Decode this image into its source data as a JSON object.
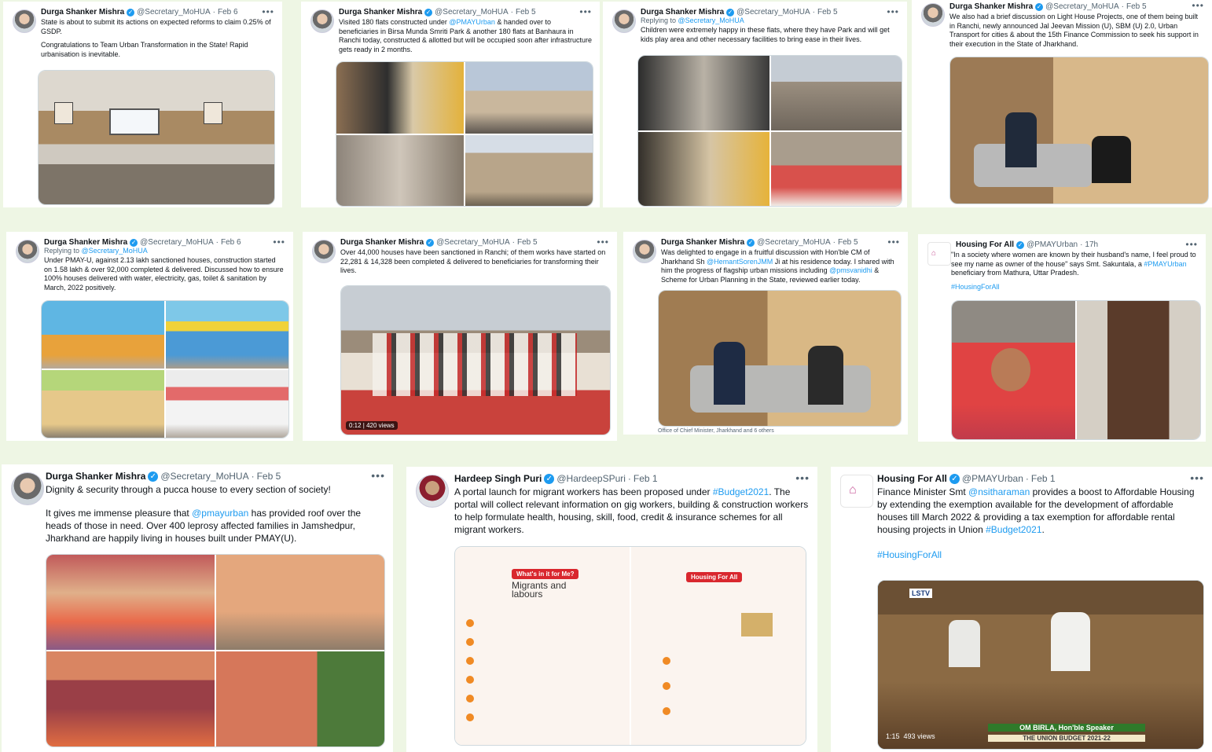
{
  "tweets": [
    {
      "name": "Durga Shanker Mishra",
      "handle": "@Secretary_MoHUA",
      "date": "Feb 6",
      "text1": "State is about to submit its actions on expected reforms to claim 0.25% of GSDP.",
      "text2": "Congratulations to Team Urban Transformation in the State! Rapid urbanisation is inevitable."
    },
    {
      "name": "Durga Shanker Mishra",
      "handle": "@Secretary_MoHUA",
      "date": "Feb 5",
      "pre": "Visited 180 flats constructed under ",
      "link": "@PMAYUrban",
      "post": " & handed over to beneficiaries in Birsa Munda Smriti Park & another 180 flats at Banhaura in Ranchi today, constructed & allotted but will be occupied soon after infrastructure gets ready in 2 months."
    },
    {
      "name": "Durga Shanker Mishra",
      "handle": "@Secretary_MoHUA",
      "date": "Feb 5",
      "replying": "Replying to",
      "reply_to": "@Secretary_MoHUA",
      "text": "Children were extremely happy in these flats, where they have Park and will get kids play area and other necessary facilities to bring ease in their lives."
    },
    {
      "name": "Durga Shanker Mishra",
      "handle": "@Secretary_MoHUA",
      "date": "Feb 5",
      "text": "We also had a brief discussion on Light House Projects, one of them being built in Ranchi, newly announced Jal Jeevan Mission (U), SBM (U) 2.0, Urban Transport for cities & about the 15th Finance Commission to seek his support in their execution in the State of Jharkhand."
    },
    {
      "name": "Durga Shanker Mishra",
      "handle": "@Secretary_MoHUA",
      "date": "Feb 6",
      "replying": "Replying to",
      "reply_to": "@Secretary_MoHUA",
      "text": "Under PMAY-U, against 2.13 lakh sanctioned houses, construction started on 1.58 lakh & over 92,000 completed & delivered. Discussed how to ensure 100% houses delivered with water, electricity, gas, toilet & sanitation by March, 2022 positively."
    },
    {
      "name": "Durga Shanker Mishra",
      "handle": "@Secretary_MoHUA",
      "date": "Feb 5",
      "text": "Over 44,000 houses have been sanctioned in Ranchi; of them works have started on 22,281 & 14,328 been completed & delivered to beneficiaries for transforming their lives.",
      "video_time": "0:12",
      "video_views": "420 views"
    },
    {
      "name": "Durga Shanker Mishra",
      "handle": "@Secretary_MoHUA",
      "date": "Feb 5",
      "pre": "Was delighted to engage in a fruitful discussion with Hon'ble CM of Jharkhand Sh ",
      "link": "@HemantSorenJMM",
      "mid": " Ji at his residence today. I shared with him the progress of flagship urban missions including ",
      "link2": "@pmsvanidhi",
      "post": " & Scheme for Urban Planning in the State, reviewed earlier today.",
      "caption": "Office of Chief Minister, Jharkhand and 6 others"
    },
    {
      "name": "Housing For All",
      "handle": "@PMAYUrban",
      "date": "17h",
      "pre": "\"In a society where women are known by their husband's name, I feel proud to see my name as owner of the house\" says Smt. Sakuntala, a ",
      "link": "#PMAYUrban",
      "post": " beneficiary from Mathura, Uttar Pradesh.",
      "hashtag": "#HousingForAll"
    },
    {
      "name": "Durga Shanker Mishra",
      "handle": "@Secretary_MoHUA",
      "date": "Feb 5",
      "text1": "Dignity & security through a pucca house to every section of society!",
      "pre": "It gives me immense pleasure that ",
      "link": "@pmayurban",
      "post": " has provided roof over the heads of those in need. Over 400 leprosy affected families in Jamshedpur, Jharkhand are happily living in houses built under PMAY(U)."
    },
    {
      "name": "Hardeep Singh Puri",
      "handle": "@HardeepSPuri",
      "date": "Feb 1",
      "pre": "A portal launch for migrant workers has been proposed under ",
      "link": "#Budget2021",
      "post": ". The portal will collect relevant information on gig workers, building & construction workers to help formulate health, housing, skill, food, credit & insurance schemes for all migrant workers.",
      "card_left_title": "What's in it for Me?",
      "card_left_sub": "Migrants and labours",
      "card_right_title": "Housing For All"
    },
    {
      "name": "Housing For All",
      "handle": "@PMAYUrban",
      "date": "Feb 1",
      "pre": "Finance Minister Smt ",
      "link": "@nsitharaman",
      "post": " provides a boost to Affordable Housing by extending the exemption available for the development of affordable houses till March 2022 & providing a tax exemption for affordable rental housing projects in Union ",
      "link2": "#Budget2021",
      "end": ".",
      "hashtag": "#HousingForAll",
      "video_time": "1:15",
      "video_views": "493 views",
      "tv_caption": "OM BIRLA, Hon'ble Speaker",
      "tv_sub": "THE UNION BUDGET 2021-22",
      "tv_logo": "LSTV"
    }
  ],
  "icons": {
    "verified": "✓",
    "more": "•••"
  }
}
